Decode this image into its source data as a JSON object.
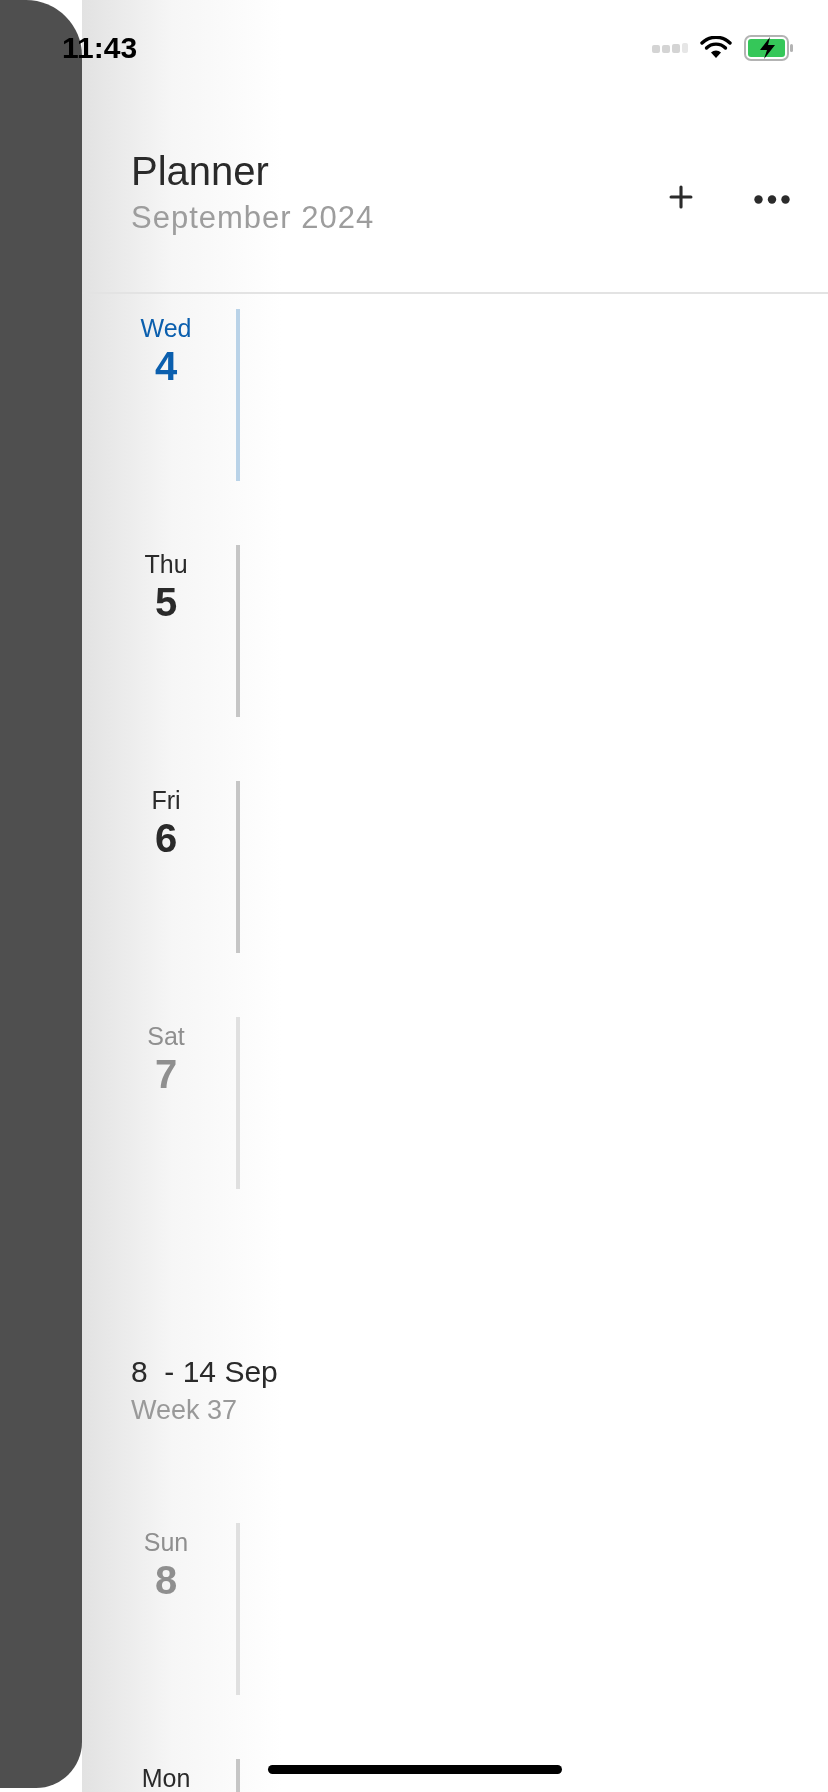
{
  "status_bar": {
    "time": "11:43"
  },
  "header": {
    "title": "Planner",
    "subtitle": "September 2024"
  },
  "timeline": [
    {
      "kind": "day",
      "weekday": "Wed",
      "date": "4",
      "selected": true,
      "weekend": false
    },
    {
      "kind": "day",
      "weekday": "Thu",
      "date": "5",
      "selected": false,
      "weekend": false
    },
    {
      "kind": "day",
      "weekday": "Fri",
      "date": "6",
      "selected": false,
      "weekend": false
    },
    {
      "kind": "day",
      "weekday": "Sat",
      "date": "7",
      "selected": false,
      "weekend": true
    },
    {
      "kind": "week",
      "range": "8  - 14 Sep",
      "week": "Week 37"
    },
    {
      "kind": "day",
      "weekday": "Sun",
      "date": "8",
      "selected": false,
      "weekend": true
    },
    {
      "kind": "day",
      "weekday": "Mon",
      "selected": false,
      "weekend": false
    }
  ]
}
